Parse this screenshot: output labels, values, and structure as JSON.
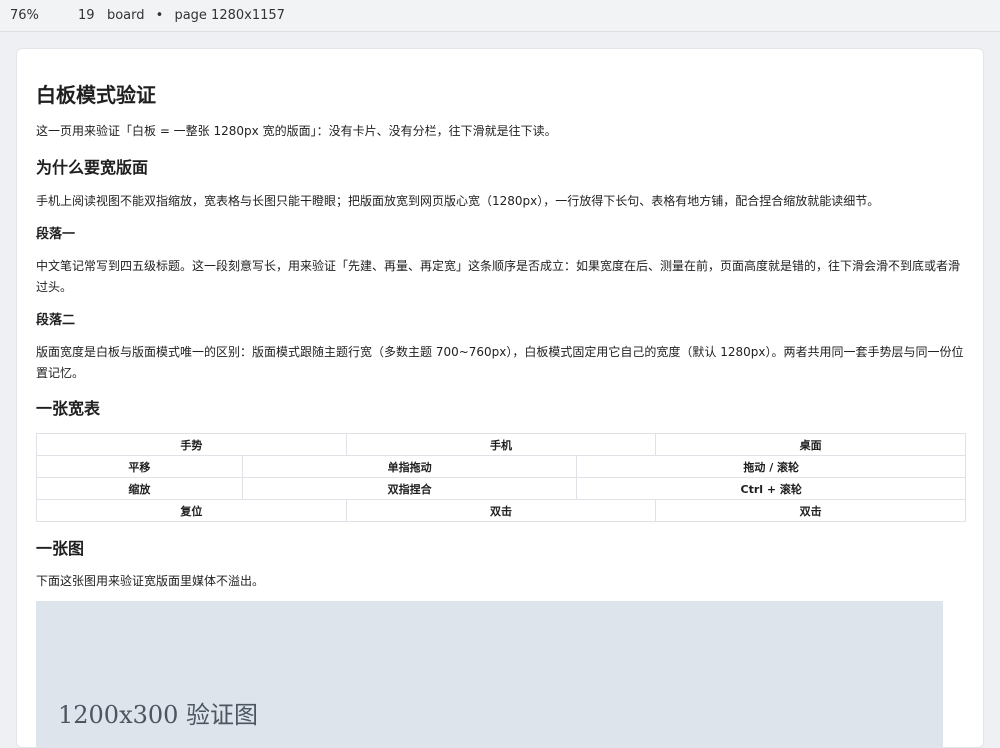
{
  "topbar": {
    "zoom": "76%",
    "count": "19",
    "mode": "board",
    "separator": "•",
    "page_size": "page 1280x1157"
  },
  "doc": {
    "title": "白板模式验证",
    "intro": "这一页用来验证「白板 = 一整张 1280px 宽的版面」：没有卡片、没有分栏，往下滑就是往下读。",
    "h_why": "为什么要宽版面",
    "p_why": "手机上阅读视图不能双指缩放，宽表格与长图只能干瞪眼；把版面放宽到网页版心宽（1280px），一行放得下长句、表格有地方铺，配合捏合缩放就能读细节。",
    "h_para1": "段落一",
    "p_para1": "中文笔记常写到四五级标题。这一段刻意写长，用来验证「先建、再量、再定宽」这条顺序是否成立：如果宽度在后、测量在前，页面高度就是错的，往下滑会滑不到底或者滑过头。",
    "h_para2": "段落二",
    "p_para2": "版面宽度是白板与版面模式唯一的区别：版面模式跟随主题行宽（多数主题 700~760px），白板模式固定用它自己的宽度（默认 1280px）。两者共用同一套手势层与同一份位置记忆。",
    "h_table": "一张宽表",
    "table": {
      "headers": [
        "手势",
        "手机",
        "桌面"
      ],
      "rows": [
        [
          "平移",
          "单指拖动",
          "拖动 / 滚轮"
        ],
        [
          "缩放",
          "双指捏合",
          "Ctrl + 滚轮"
        ],
        [
          "复位",
          "双击",
          "双击"
        ]
      ]
    },
    "h_image": "一张图",
    "p_image": "下面这张图用来验证宽版面里媒体不溢出。",
    "image_caption": "1200x300 验证图"
  }
}
